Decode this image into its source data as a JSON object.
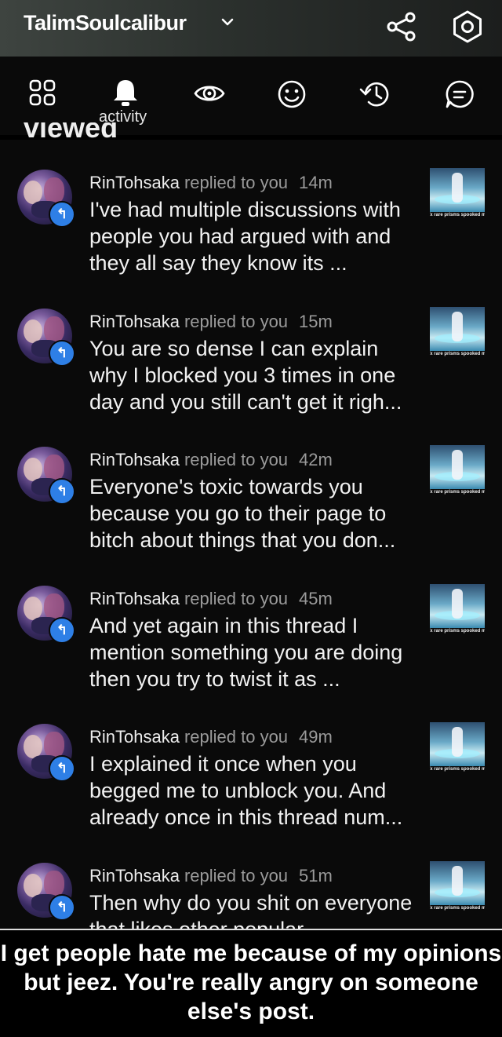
{
  "header": {
    "title": "TalimSoulcalibur",
    "icons": [
      "chevron-down-icon",
      "share-icon",
      "settings-icon"
    ]
  },
  "tabs": {
    "active_label": "activity",
    "icons": [
      "grid-icon",
      "bell-icon",
      "eye-icon",
      "smiley-icon",
      "history-icon",
      "chat-icon"
    ]
  },
  "section_heading": "viewed",
  "notifications": [
    {
      "user": "RinTohsaka",
      "action": "replied to you",
      "time": "14m",
      "text": "I've had multiple discussions with people you had argued with and they all say they know its ...",
      "thumb_caption": "ſx rare prisms spooked m"
    },
    {
      "user": "RinTohsaka",
      "action": "replied to you",
      "time": "15m",
      "text": "You are so dense I can explain why I blocked you 3 times in one day and you still can't get it righ...",
      "thumb_caption": "ſx rare prisms spooked m"
    },
    {
      "user": "RinTohsaka",
      "action": "replied to you",
      "time": "42m",
      "text": "Everyone's toxic towards you because you go to their page to bitch about things that you don...",
      "thumb_caption": "ſx rare prisms spooked m"
    },
    {
      "user": "RinTohsaka",
      "action": "replied to you",
      "time": "45m",
      "text": "And yet again in this thread I mention something you are doing then you try to twist it as ...",
      "thumb_caption": "ſx rare prisms spooked m"
    },
    {
      "user": "RinTohsaka",
      "action": "replied to you",
      "time": "49m",
      "text": "I explained it once when you begged me to unblock you. And already once in this thread num...",
      "thumb_caption": "ſx rare prisms spooked m"
    },
    {
      "user": "RinTohsaka",
      "action": "replied to you",
      "time": "51m",
      "text": "Then why do you shit on everyone that likes other popular",
      "thumb_caption": "ſx rare prisms spooked m"
    }
  ],
  "reply_badge_glyph": "↰",
  "caption": "I get people hate me because of my opinions but jeez. You're really angry on someone else's post.",
  "colors": {
    "badge": "#2e7fe6",
    "muted_text": "#9a9a9a",
    "background": "#0a0a0a"
  }
}
